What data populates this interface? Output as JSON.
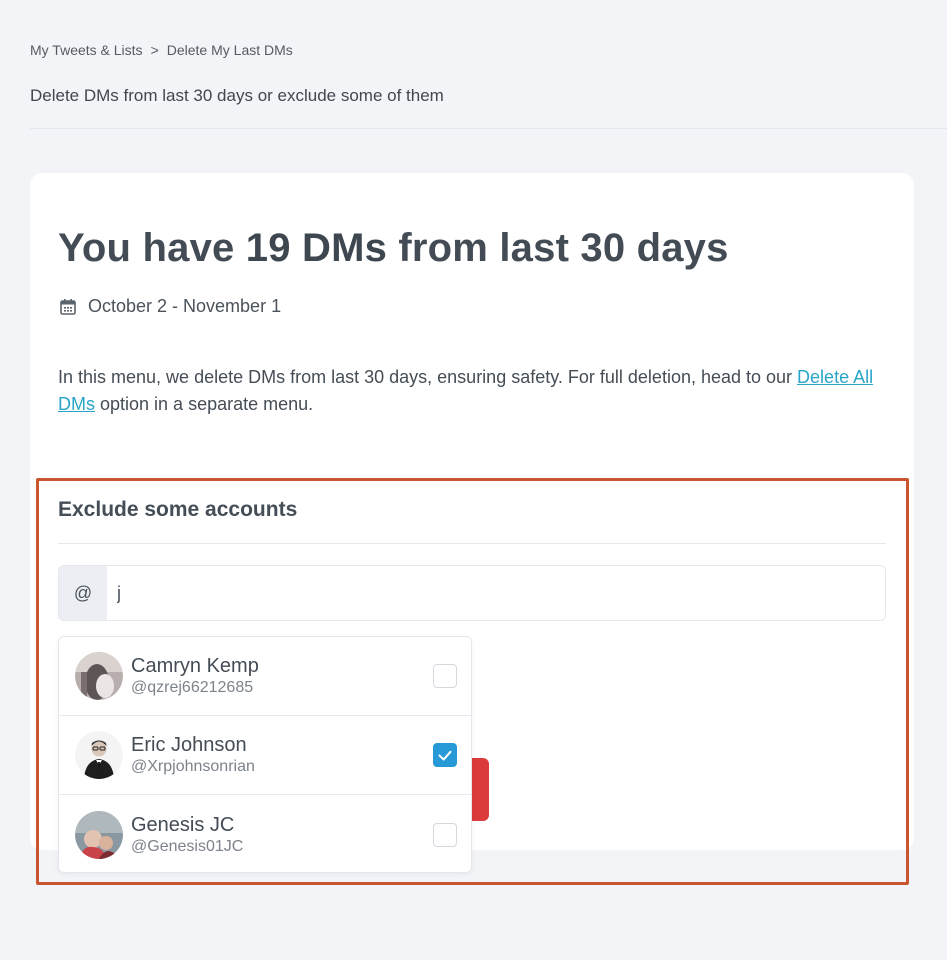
{
  "breadcrumb": {
    "items": [
      "My Tweets & Lists",
      "Delete My Last DMs"
    ],
    "separator": ">"
  },
  "page_subtitle": "Delete DMs from last 30 days or exclude some of them",
  "headline": {
    "prefix": "You have ",
    "count": "19 DMs",
    "suffix": " from last 30 days"
  },
  "date_range": "October 2 - November 1",
  "description": {
    "text_before": "In this menu, we delete DMs from last 30 days, ensuring safety. For full deletion, head to our ",
    "link": "Delete All DMs",
    "text_after": " option in a separate menu."
  },
  "exclude": {
    "title": "Exclude some accounts",
    "search_prefix": "@",
    "search_value": "j",
    "results": [
      {
        "name": "Camryn Kemp",
        "handle": "@qzrej66212685",
        "checked": false
      },
      {
        "name": "Eric Johnson",
        "handle": "@Xrpjohnsonrian",
        "checked": true
      },
      {
        "name": "Genesis JC",
        "handle": "@Genesis01JC",
        "checked": false
      }
    ]
  },
  "colors": {
    "accent_link": "#2aa5c8",
    "checkbox_checked": "#2699d6",
    "highlight_frame": "#c8552f",
    "danger": "#dc3b3b"
  },
  "icons": {
    "breadcrumb_separator": "chevron-right-icon",
    "date": "calendar-icon",
    "checkmark": "check-icon"
  }
}
